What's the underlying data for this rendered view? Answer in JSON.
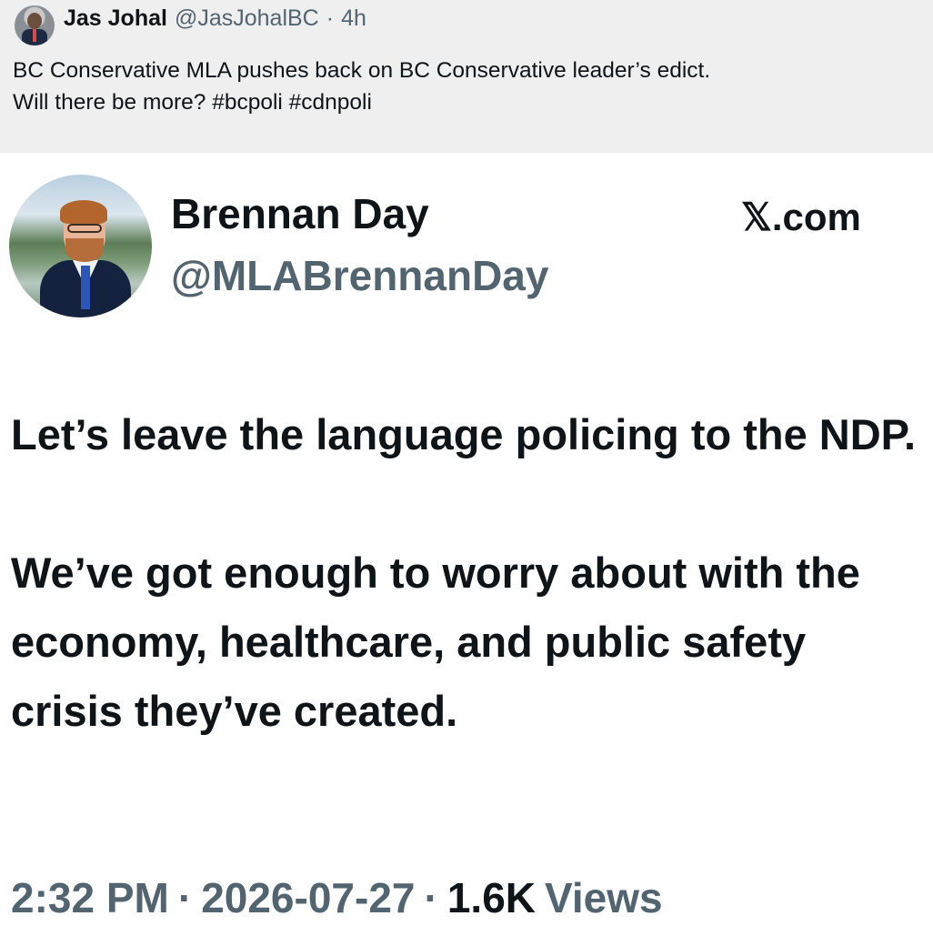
{
  "outer_post": {
    "author_name": "Jas Johal",
    "author_handle": "@JasJohalBC",
    "separator": "·",
    "time": "4h",
    "text_line1": "BC Conservative MLA pushes back on BC Conservative leader’s edict.",
    "text_line2": "Will there be more? #bcpoli #cdnpoli"
  },
  "embedded_post": {
    "author_name": "Brennan Day",
    "author_handle": "@MLABrennanDay",
    "source": "𝕏.com",
    "paragraph1": "Let’s leave the language policing to the NDP.",
    "paragraph2": "We’ve got enough to worry about with the economy, healthcare, and public safety crisis they’ve created.",
    "time": "2:32 PM",
    "separator": "·",
    "date": "2026-07-27",
    "views_count": "1.6K",
    "views_label": "Views"
  },
  "colors": {
    "header_bg": "#efefef",
    "text": "#0f1419",
    "muted": "#536471"
  }
}
